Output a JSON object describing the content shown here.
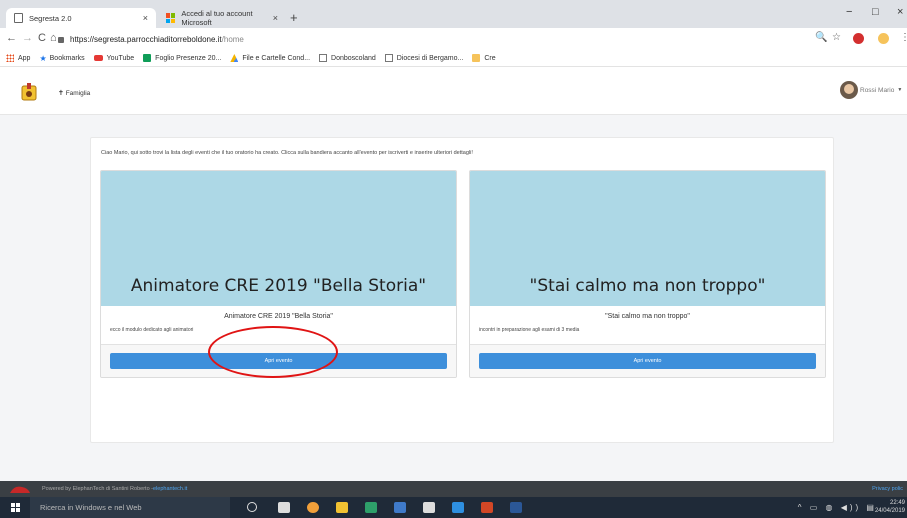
{
  "browser": {
    "tabs": [
      {
        "label": "Segresta 2.0",
        "close": "×"
      },
      {
        "label": "Accedi al tuo account Microsoft",
        "close": "×"
      }
    ],
    "new_tab": "+",
    "window_controls": {
      "minimize": "−",
      "maximize": "□",
      "close": "×"
    },
    "nav": {
      "back": "←",
      "forward": "→",
      "reload": "C",
      "home": "⌂"
    },
    "url_host": "https://segresta.parrocchiaditorreboldone.it",
    "url_path": "/home",
    "toolbar_icons": {
      "zoom": "🔍",
      "star": "☆",
      "menu": "⋮"
    },
    "bookmarks": [
      {
        "label": "App",
        "color": "#e64a19"
      },
      {
        "label": "Bookmarks",
        "color": "#1a73e8"
      },
      {
        "label": "YouTube",
        "color": "#e53935"
      },
      {
        "label": "Foglio Presenze 20...",
        "color": "#0f9d58"
      },
      {
        "label": "File e Cartelle Cond...",
        "color": "#f4b400"
      },
      {
        "label": "Donboscoland",
        "color": "#888888"
      },
      {
        "label": "Diocesi di Bergamo...",
        "color": "#888888"
      },
      {
        "label": "Cre",
        "color": "#f6c35b"
      }
    ]
  },
  "site": {
    "nav_link": "Famiglia",
    "user_name": "Rossi Mario",
    "user_caret": "▼",
    "intro": "Ciao Mario, qui sotto trovi la lista degli eventi che il tuo oratorio ha creato. Clicca sulla bandiera accanto all'evento per iscriverti e inserire ulteriori dettagli!",
    "events": [
      {
        "banner_title": "Animatore CRE 2019 \"Bella Storia\"",
        "title": "Animatore CRE 2019 \"Bella Storia\"",
        "description": "ecco il modulo dedicato agli animatori",
        "button": "Apri evento"
      },
      {
        "banner_title": "\"Stai calmo ma non troppo\"",
        "title": "\"Stai calmo ma non troppo\"",
        "description": "incontri in preparazione agli esami di 3 media",
        "button": "Apri evento"
      }
    ],
    "footer_prefix": "Powered by ElephanTech di Santini Roberto - ",
    "footer_link": "elephantech.it",
    "footer_privacy": "Privacy polic"
  },
  "taskbar": {
    "search_placeholder": "Ricerca in Windows e nel Web",
    "time": "22:49",
    "date": "24/04/2019",
    "tray": "^ ▭ ◍ ◀)) ▤"
  }
}
